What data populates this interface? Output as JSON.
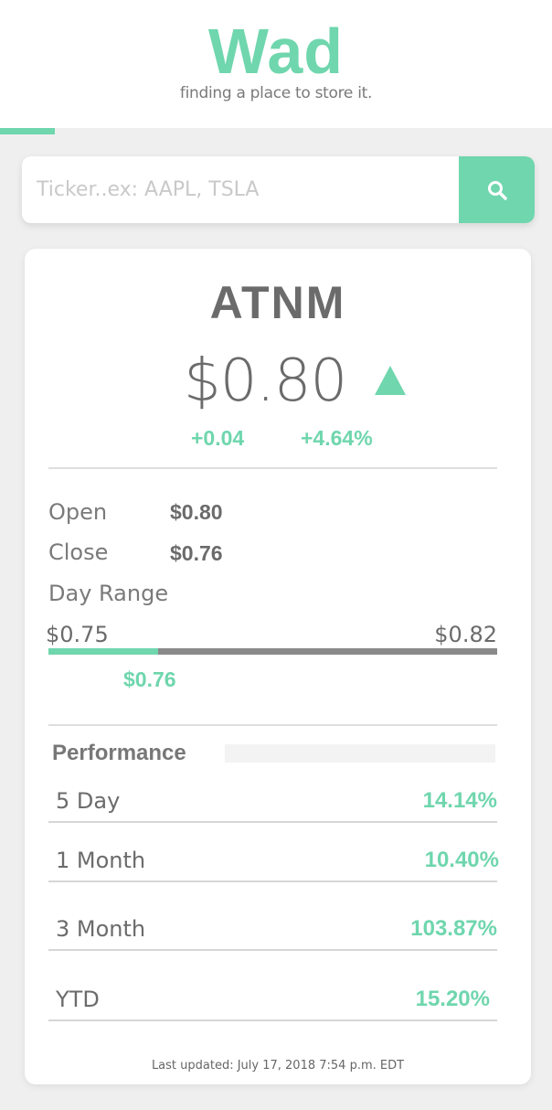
{
  "header": {
    "logo": "Wad",
    "tagline": "finding a place to store it."
  },
  "loading_progress": 0.1,
  "search": {
    "placeholder": "Ticker..ex: AAPL, TSLA",
    "button_icon": "search-icon"
  },
  "quote": {
    "ticker": "ATNM",
    "price": "$0.80",
    "direction_icon": "up-triangle-icon",
    "change": "+0.04",
    "change_percent": "+4.64%"
  },
  "stats": {
    "open_label": "Open",
    "open_value": "$0.80",
    "close_label": "Close",
    "close_value": "$0.76",
    "range_label": "Day Range",
    "range_low": "$0.75",
    "range_high": "$0.82",
    "range_current": "$0.76",
    "range_position": 0.245
  },
  "performance": {
    "title": "Performance",
    "rows": [
      {
        "label": "5 Day",
        "value": "14.14%"
      },
      {
        "label": "1 Month",
        "value": "10.40%"
      },
      {
        "label": "3 Month",
        "value": "103.87%"
      },
      {
        "label": "YTD",
        "value": "15.20%"
      }
    ]
  },
  "last_updated": "Last updated: July 17, 2018 7:54 p.m. EDT",
  "colors": {
    "accent": "#6fd6ad",
    "text": "#6b6b6b",
    "background": "#efefef"
  }
}
